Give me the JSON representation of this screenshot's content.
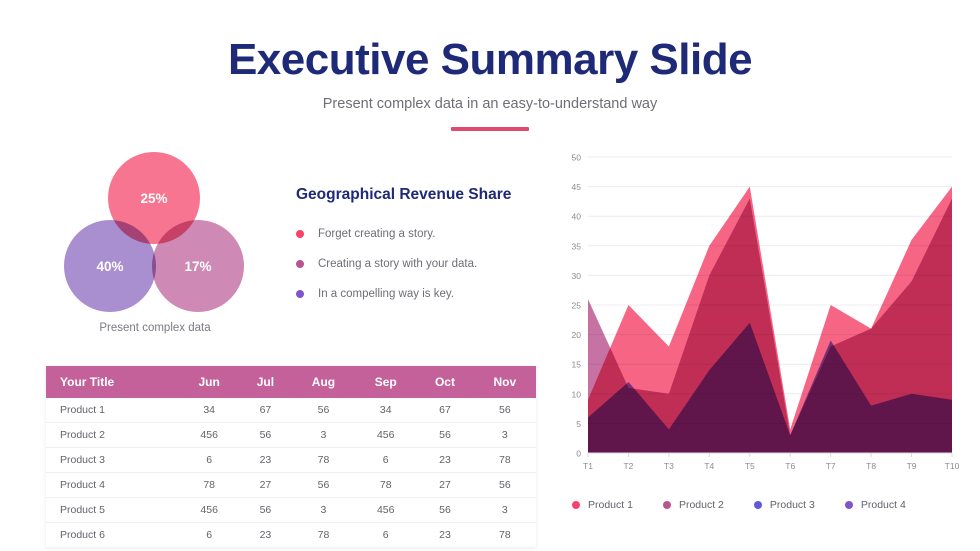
{
  "header": {
    "title": "Executive Summary Slide",
    "subtitle": "Present complex data in an easy-to-understand way",
    "divider_color": "#de4b6e"
  },
  "venn": {
    "caption": "Present complex data",
    "circles": [
      {
        "label": "25%",
        "color": "#f65e7e",
        "position": "top"
      },
      {
        "label": "40%",
        "color": "#9b7bc8",
        "position": "left"
      },
      {
        "label": "17%",
        "color": "#c677a8",
        "position": "right"
      }
    ]
  },
  "list": {
    "heading": "Geographical Revenue Share",
    "items": [
      {
        "text": "Forget creating a story.",
        "color": "#f6436a"
      },
      {
        "text": "Creating a story with your data.",
        "color": "#b9548f"
      },
      {
        "text": "In a compelling way is key.",
        "color": "#8155c8"
      }
    ]
  },
  "table": {
    "header_color": "#c4619a",
    "columns": [
      "Your Title",
      "Jun",
      "Jul",
      "Aug",
      "Sep",
      "Oct",
      "Nov"
    ],
    "rows": [
      [
        "Product 1",
        "34",
        "67",
        "56",
        "34",
        "67",
        "56"
      ],
      [
        "Product 2",
        "456",
        "56",
        "3",
        "456",
        "56",
        "3"
      ],
      [
        "Product 3",
        "6",
        "23",
        "78",
        "6",
        "23",
        "78"
      ],
      [
        "Product 4",
        "78",
        "27",
        "56",
        "78",
        "27",
        "56"
      ],
      [
        "Product 5",
        "456",
        "56",
        "3",
        "456",
        "56",
        "3"
      ],
      [
        "Product 6",
        "6",
        "23",
        "78",
        "6",
        "23",
        "78"
      ]
    ]
  },
  "chart_data": {
    "type": "area",
    "title": "",
    "xlabel": "",
    "ylabel": "",
    "ylim": [
      0,
      50
    ],
    "yticks": [
      0,
      5,
      10,
      15,
      20,
      25,
      30,
      35,
      40,
      45,
      50
    ],
    "grid": true,
    "legend_position": "bottom",
    "categories": [
      "T1",
      "T2",
      "T3",
      "T4",
      "T5",
      "T6",
      "T7",
      "T8",
      "T9",
      "T10"
    ],
    "series": [
      {
        "name": "Product 1",
        "color": "#f6436a",
        "values": [
          9,
          25,
          18,
          35,
          45,
          4,
          25,
          21,
          36,
          45
        ]
      },
      {
        "name": "Product 2",
        "color": "#b9548f",
        "values": [
          26,
          11,
          10,
          30,
          43,
          3,
          18,
          21,
          29,
          43
        ]
      },
      {
        "name": "Product 3",
        "color": "#6257d4",
        "values": [
          6,
          12,
          4,
          14,
          22,
          3,
          19,
          8,
          10,
          9
        ]
      },
      {
        "name": "Product 4",
        "color": "#8155c8",
        "values": []
      }
    ]
  }
}
